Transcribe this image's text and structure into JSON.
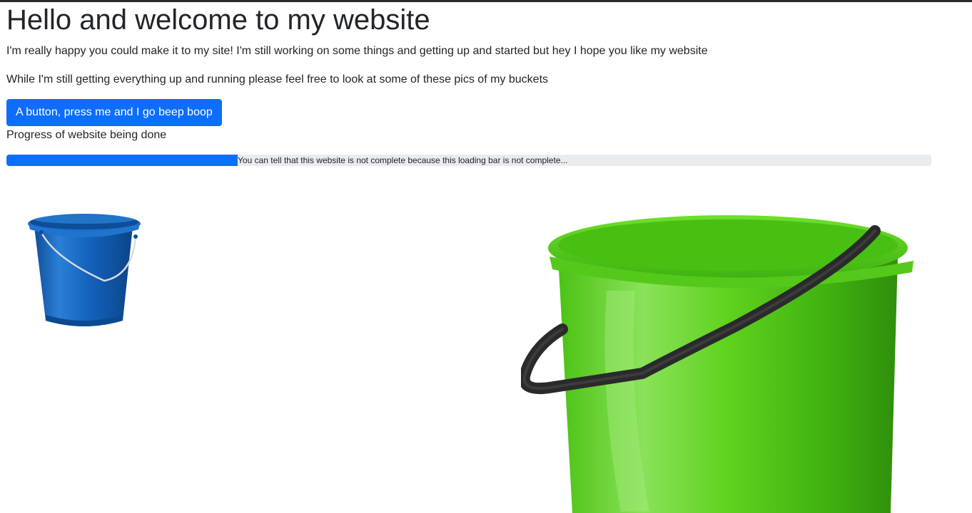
{
  "page": {
    "heading": "Hello and welcome to my website",
    "intro": "I'm really happy you could make it to my site! I'm still working on some things and getting up and started but hey I hope you like my website",
    "buckets_note": "While I'm still getting everything up and running please feel free to look at some of these pics of my buckets"
  },
  "button": {
    "label": "A button, press me and I go beep boop",
    "color": "#0d6efd"
  },
  "progress": {
    "label": "Progress of website being done",
    "value_percent": 25,
    "bar_text": "You can tell that this website is not complete because this loading bar is not complete...",
    "fill_color": "#0d6efd",
    "track_color": "#e9ecef"
  },
  "images": {
    "small_bucket": {
      "subject": "blue-bucket",
      "color": "#1466c0"
    },
    "large_bucket": {
      "subject": "green-bucket",
      "color": "#5fd21e"
    }
  }
}
